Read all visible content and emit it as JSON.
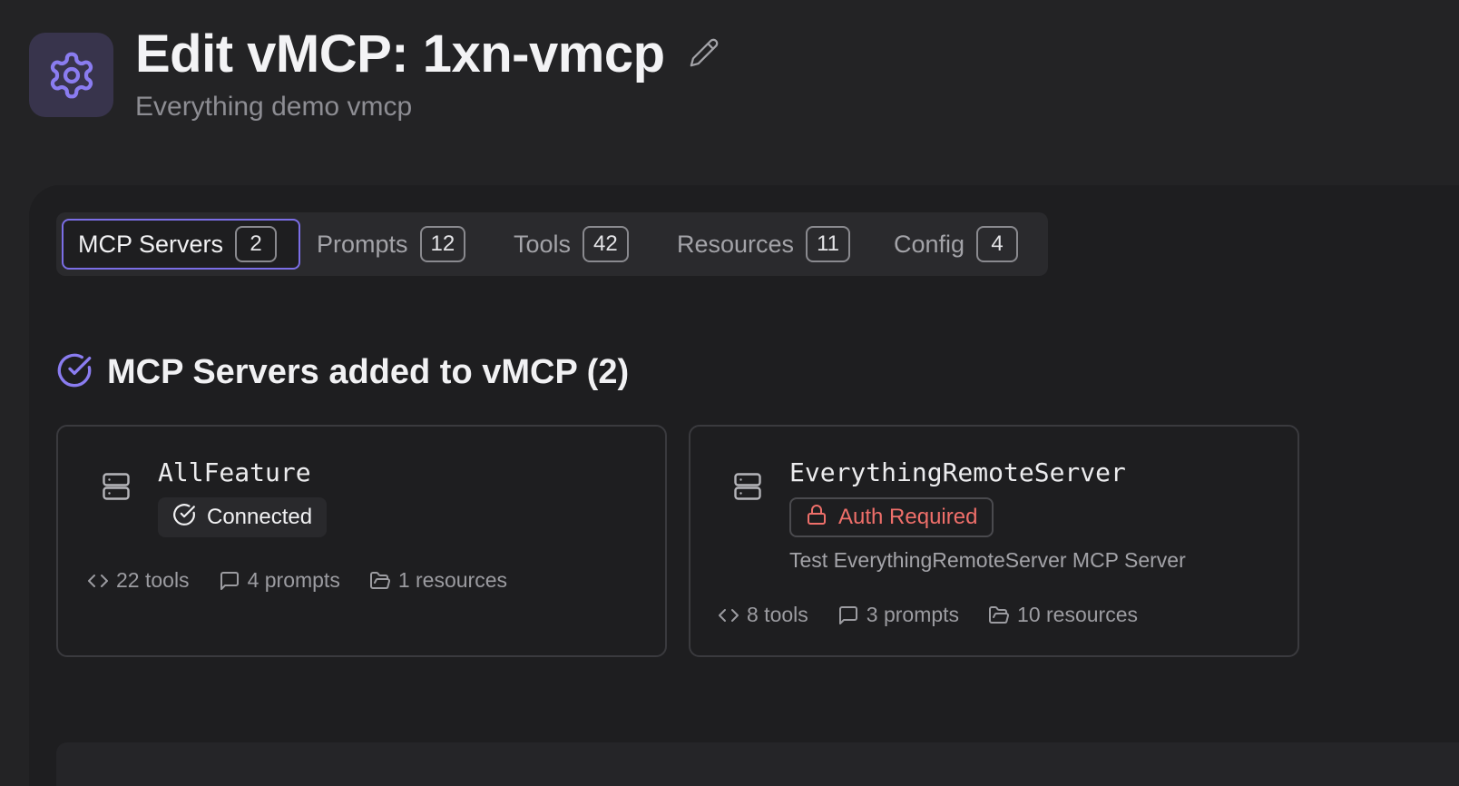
{
  "header": {
    "title": "Edit vMCP: 1xn-vmcp",
    "subtitle": "Everything demo vmcp",
    "icon": "gear-icon",
    "edit_icon": "pencil-icon",
    "accent_color": "#7b6ee6"
  },
  "tabs": [
    {
      "label": "MCP Servers",
      "count": "2",
      "active": true
    },
    {
      "label": "Prompts",
      "count": "12",
      "active": false
    },
    {
      "label": "Tools",
      "count": "42",
      "active": false
    },
    {
      "label": "Resources",
      "count": "11",
      "active": false
    },
    {
      "label": "Config",
      "count": "4",
      "active": false
    }
  ],
  "section": {
    "title": "MCP Servers added to vMCP (2)",
    "icon": "check-circle-icon"
  },
  "servers": [
    {
      "name": "AllFeature",
      "status": "Connected",
      "status_icon": "check-circle-icon",
      "status_color": "#f1f1f3",
      "tools": "22 tools",
      "prompts": "4 prompts",
      "resources": "1 resources"
    },
    {
      "name": "EverythingRemoteServer",
      "status": "Auth Required",
      "status_icon": "lock-icon",
      "status_color": "#ef6f6a",
      "description": "Test EverythingRemoteServer MCP Server",
      "tools": "8 tools",
      "prompts": "3 prompts",
      "resources": "10 resources"
    }
  ]
}
